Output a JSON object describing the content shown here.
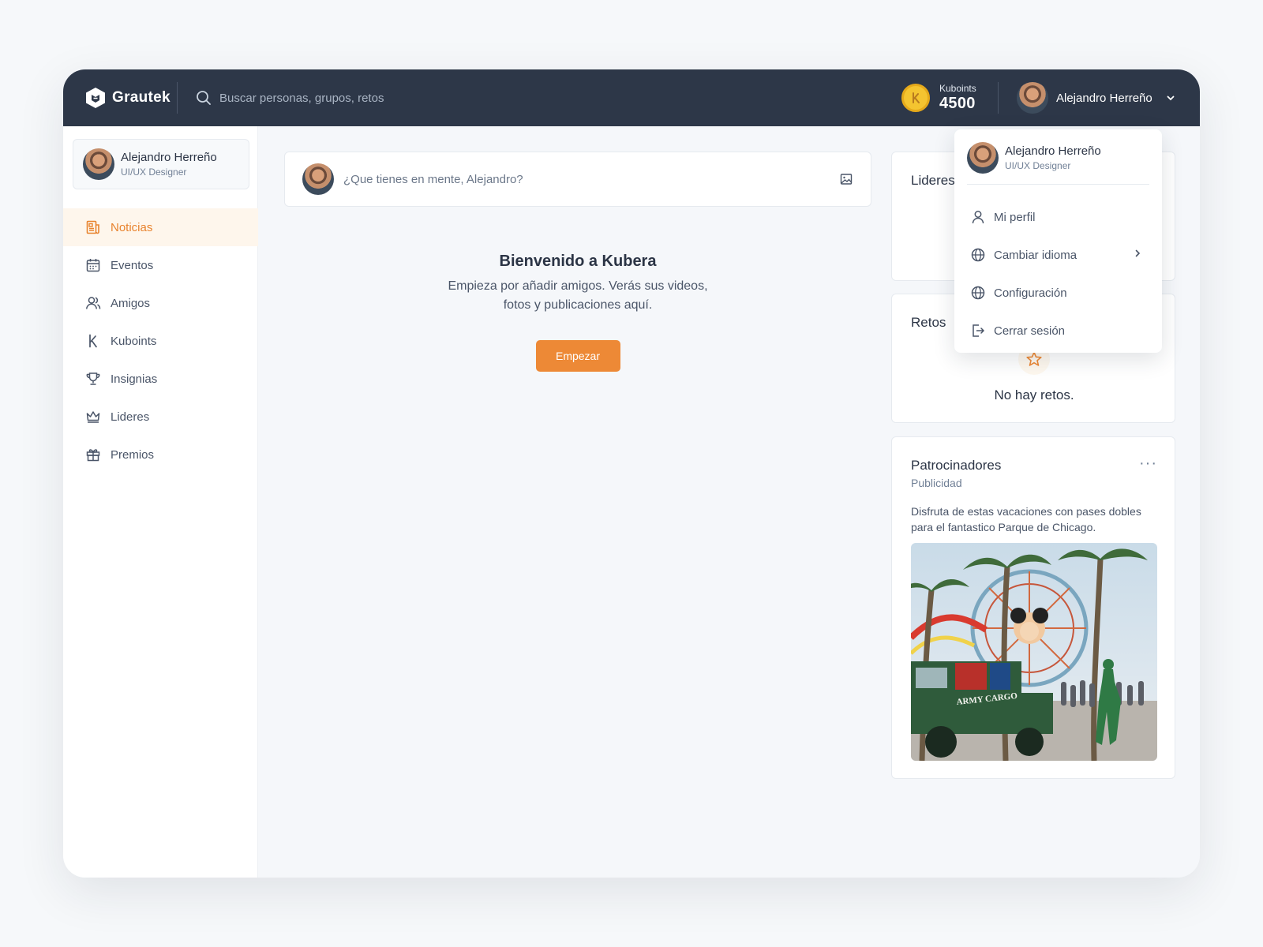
{
  "brand": {
    "name": "Grautek"
  },
  "search": {
    "placeholder": "Buscar personas, grupos, retos"
  },
  "points": {
    "label": "Kuboints",
    "value": "4500"
  },
  "user": {
    "name": "Alejandro Herreño",
    "role": "UI/UX Designer"
  },
  "sidebar": {
    "items": [
      {
        "label": "Noticias",
        "icon": "newspaper-icon",
        "active": true
      },
      {
        "label": "Eventos",
        "icon": "calendar-icon"
      },
      {
        "label": "Amigos",
        "icon": "users-icon"
      },
      {
        "label": "Kuboints",
        "icon": "kuboints-icon"
      },
      {
        "label": "Insignias",
        "icon": "trophy-icon"
      },
      {
        "label": "Lideres",
        "icon": "crown-icon"
      },
      {
        "label": "Premios",
        "icon": "gift-icon"
      }
    ]
  },
  "composer": {
    "placeholder": "¿Que tienes en mente, Alejandro?"
  },
  "welcome": {
    "title": "Bienvenido a Kubera",
    "line1": "Empieza por añadir amigos. Verás sus videos,",
    "line2": "fotos y publicaciones aquí.",
    "button": "Empezar"
  },
  "leaders": {
    "title": "Lideres"
  },
  "challenges": {
    "title": "Retos",
    "empty": "No hay retos."
  },
  "sponsors": {
    "title": "Patrocinadores",
    "subtitle": "Publicidad",
    "more": "···",
    "text": "Disfruta de estas vacaciones con pases dobles para el fantastico Parque de Chicago.",
    "image_text": "ARMY CARGO"
  },
  "dropdown": {
    "items": [
      {
        "label": "Mi perfil",
        "icon": "user-icon"
      },
      {
        "label": "Cambiar idioma",
        "icon": "globe-icon",
        "submenu": true
      },
      {
        "label": "Configuración",
        "icon": "globe-icon"
      },
      {
        "label": "Cerrar sesión",
        "icon": "logout-icon"
      }
    ]
  },
  "colors": {
    "accent": "#ed8936",
    "topbar": "#2d3748",
    "active_bg": "#fef6ec",
    "coin": "#f4c430"
  }
}
